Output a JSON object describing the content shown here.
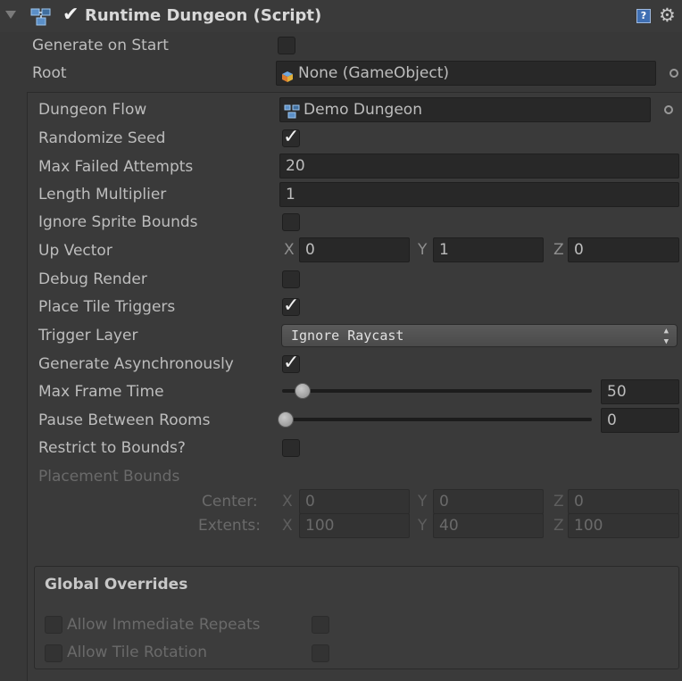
{
  "header": {
    "title": "Runtime Dungeon (Script)",
    "enabled": true
  },
  "generate_on_start": {
    "label": "Generate on Start",
    "checked": false
  },
  "root": {
    "label": "Root",
    "value": "None (GameObject)"
  },
  "dungeon_flow": {
    "label": "Dungeon Flow",
    "value": "Demo Dungeon"
  },
  "randomize_seed": {
    "label": "Randomize Seed",
    "checked": true
  },
  "max_failed_attempts": {
    "label": "Max Failed Attempts",
    "value": "20"
  },
  "length_multiplier": {
    "label": "Length Multiplier",
    "value": "1"
  },
  "ignore_sprite_bounds": {
    "label": "Ignore Sprite Bounds",
    "checked": false
  },
  "up_vector": {
    "label": "Up Vector",
    "x_label": "X",
    "x": "0",
    "y_label": "Y",
    "y": "1",
    "z_label": "Z",
    "z": "0"
  },
  "debug_render": {
    "label": "Debug Render",
    "checked": false
  },
  "place_tile_triggers": {
    "label": "Place Tile Triggers",
    "checked": true
  },
  "trigger_layer": {
    "label": "Trigger Layer",
    "value": "Ignore Raycast"
  },
  "generate_async": {
    "label": "Generate Asynchronously",
    "checked": true
  },
  "max_frame_time": {
    "label": "Max Frame Time",
    "value": "50",
    "fraction": 0.05
  },
  "pause_between_rooms": {
    "label": "Pause Between Rooms",
    "value": "0",
    "fraction": 0.0
  },
  "restrict_to_bounds": {
    "label": "Restrict to Bounds?",
    "checked": false
  },
  "placement_bounds": {
    "label": "Placement Bounds",
    "center": {
      "label": "Center:",
      "x_label": "X",
      "x": "0",
      "y_label": "Y",
      "y": "0",
      "z_label": "Z",
      "z": "0"
    },
    "extents": {
      "label": "Extents:",
      "x_label": "X",
      "x": "100",
      "y_label": "Y",
      "y": "40",
      "z_label": "Z",
      "z": "100"
    }
  },
  "global_overrides": {
    "title": "Global Overrides",
    "allow_immediate_repeats": {
      "label": "Allow Immediate Repeats"
    },
    "allow_tile_rotation": {
      "label": "Allow Tile Rotation"
    }
  },
  "icons": {
    "script": "script-icon",
    "help": "help-icon",
    "settings": "gear-icon",
    "cube": "gameobject-icon",
    "flow": "dungeon-flow-icon",
    "picker": "object-picker-icon"
  },
  "colors": {
    "background": "#383838",
    "panel": "#3a3a3a",
    "field": "#282828",
    "text": "#bdbdbd"
  }
}
